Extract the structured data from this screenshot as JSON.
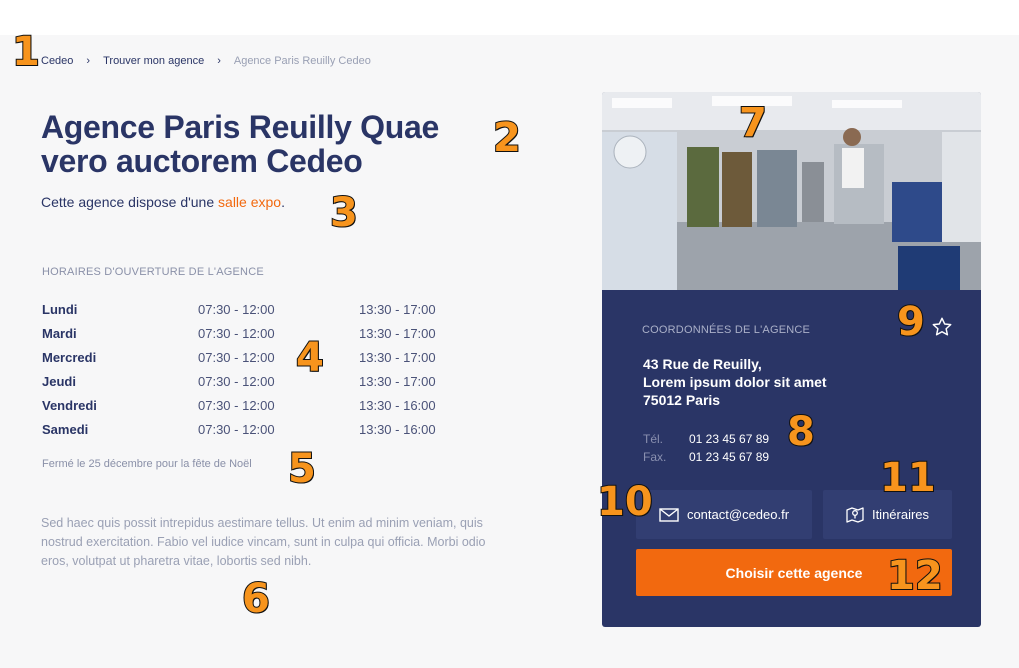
{
  "breadcrumb": {
    "items": [
      "Cedeo",
      "Trouver mon agence"
    ],
    "current": "Agence Paris Reuilly Cedeo",
    "separator": "›"
  },
  "title": "Agence Paris Reuilly Quae vero auctorem Cedeo",
  "subtitle": {
    "prefix": "Cette agence dispose d'une ",
    "link": "salle expo",
    "suffix": "."
  },
  "hours": {
    "label": "HORAIRES D'OUVERTURE DE L'AGENCE",
    "rows": [
      {
        "day": "Lundi",
        "am": "07:30 - 12:00",
        "pm": "13:30 - 17:00"
      },
      {
        "day": "Mardi",
        "am": "07:30 - 12:00",
        "pm": "13:30 - 17:00"
      },
      {
        "day": "Mercredi",
        "am": "07:30 - 12:00",
        "pm": "13:30 - 17:00"
      },
      {
        "day": "Jeudi",
        "am": "07:30 - 12:00",
        "pm": "13:30 - 17:00"
      },
      {
        "day": "Vendredi",
        "am": "07:30 - 12:00",
        "pm": "13:30 - 16:00"
      },
      {
        "day": "Samedi",
        "am": "07:30 - 12:00",
        "pm": "13:30 - 16:00"
      }
    ],
    "closed_note": "Fermé le 25 décembre pour la fête de Noël"
  },
  "description": "Sed haec quis possit intrepidus aestimare tellus. Ut enim ad minim veniam, quis nostrud exercitation. Fabio vel iudice vincam, sunt in culpa qui officia. Morbi odio eros, volutpat ut pharetra vitae, lobortis sed nibh.",
  "card": {
    "label": "COORDONNÉES DE L'AGENCE",
    "address": [
      "43 Rue de Reuilly,",
      "Lorem ipsum dolor sit amet",
      "75012 Paris"
    ],
    "tel_label": "Tél.",
    "tel": "01 23 45 67 89",
    "fax_label": "Fax.",
    "fax": "01 23 45 67 89",
    "email_button": "contact@cedeo.fr",
    "itinerary_button": "Itinéraires",
    "choose_button": "Choisir cette agence"
  },
  "markers": [
    "1",
    "2",
    "3",
    "4",
    "5",
    "6",
    "7",
    "8",
    "9",
    "10",
    "11",
    "12"
  ],
  "colors": {
    "navy": "#2a3566",
    "orange": "#f2690f",
    "marker": "#f7941d"
  },
  "icons": {
    "favorite": "star-icon",
    "email": "envelope-icon",
    "itinerary": "map-pin-icon"
  }
}
